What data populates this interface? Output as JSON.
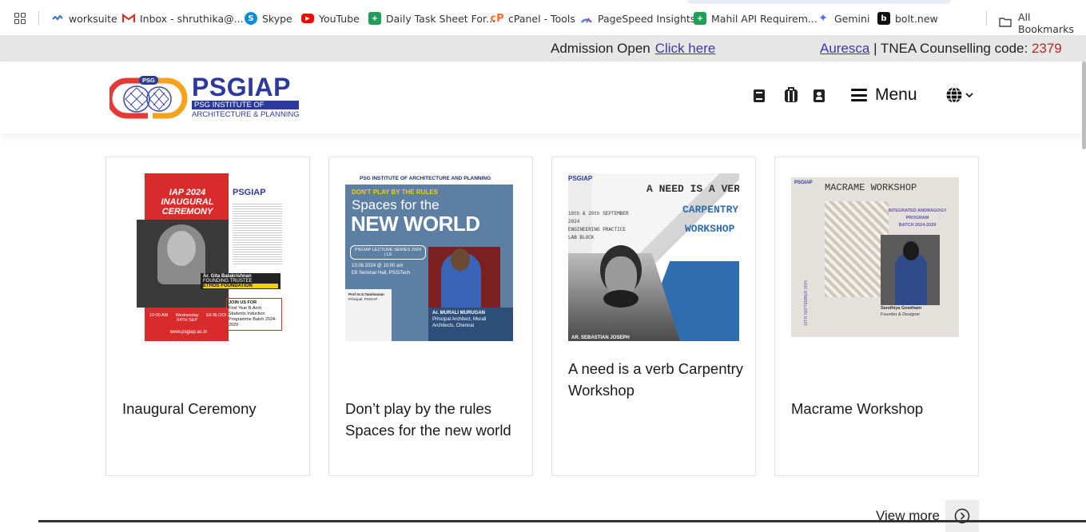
{
  "bookmarks": {
    "items": [
      {
        "label": "worksuite",
        "icon": "worksuite-icon",
        "color": "#2d6fd3"
      },
      {
        "label": "Inbox - shruthika@...",
        "icon": "gmail-icon",
        "color": "#d93025"
      },
      {
        "label": "Skype",
        "icon": "skype-icon",
        "color": "#0b8bdc"
      },
      {
        "label": "YouTube",
        "icon": "youtube-icon",
        "color": "#ff0000"
      },
      {
        "label": "Daily Task Sheet For...",
        "icon": "sheets-icon",
        "color": "#1e9e57"
      },
      {
        "label": "cPanel - Tools",
        "icon": "cpanel-icon",
        "color": "#ff6c2c"
      },
      {
        "label": "PageSpeed Insights",
        "icon": "pagespeed-icon",
        "color": "#4285f4"
      },
      {
        "label": "Mahil API Requirem...",
        "icon": "sheets-icon",
        "color": "#1e9e57"
      },
      {
        "label": "Gemini",
        "icon": "gemini-icon",
        "color": "#4a6cf7"
      },
      {
        "label": "bolt.new",
        "icon": "bolt-icon",
        "color": "#111111"
      }
    ],
    "all_label": "All Bookmarks"
  },
  "infobar": {
    "admission_text": "Admission Open",
    "admission_link": "Click here",
    "brand_link": "Auresca",
    "tnea_text": " | TNEA Counselling code: ",
    "tnea_code": "2379"
  },
  "header": {
    "logo_name": "PSGIAP",
    "logo_badge": "PSG",
    "logo_sub1": "PSG INSTITUTE OF",
    "logo_sub2": "ARCHITECTURE & PLANNING",
    "menu_label": "Menu",
    "language_icon": "globe-icon"
  },
  "cards": [
    {
      "title": "Inaugural Ceremony",
      "poster": {
        "heading1": "IAP 2024",
        "heading2": "INAUGURAL",
        "heading3": "CEREMONY",
        "brand": "PSGIAP",
        "speaker": "Ar. Gita Balakrishnan",
        "role": "FOUNDING TRUSTEE",
        "org": "ETHOS FOUNDATION",
        "time": "10:00 AM",
        "day": "Wednesday",
        "date": "04TH SEP",
        "venue": "E6 BLOCK",
        "join": "JOIN US FOR",
        "join_detail": "First Year B.Arch Students Induction Programme Batch 2024-2029",
        "url": "www.psgiap.ac.in"
      }
    },
    {
      "title": "Don’t play by the rules Spaces for the new world",
      "poster": {
        "header": "PSG INSTITUTE OF ARCHITECTURE AND PLANNING",
        "tag": "DON'T PLAY BY THE RULES",
        "line1": "Spaces for the",
        "line2": "NEW WORLD",
        "series": "PSGIAP LECTURE SERIES 2024 | L9",
        "datetime": "10.08.2024 @ 10:00 am",
        "venue": "E6 Seminar Hall, PSGiTech",
        "speaker": "Ar. MURALI MURUGAN",
        "speaker_role": "Principal Architect, Murali Architects, Chennai",
        "host1": "Prof Ar.S.Tamilvanan",
        "host1_role": "Principal, PSGIAP"
      }
    },
    {
      "title": "A need is a verb Carpentry Workshop",
      "poster": {
        "brand": "PSGIAP",
        "line1": "A NEED IS A VERB",
        "line2": "CARPENTRY",
        "line3": "WORKSHOP",
        "date": "19th & 20th SEPTEMBER 2024",
        "venue": "ENGINEERING PRACTICE LAB BLOCK",
        "speaker": "AR. SEBASTIAN JOSEPH"
      }
    },
    {
      "title": "Macrame Workshop",
      "poster": {
        "brand": "PSGIAP",
        "heading": "MACRAME WORKSHOP",
        "program": "INTEGRATED ANDRAGOGY PROGRAM",
        "batch": "BATCH 2024-2029",
        "date": "12TH SEPTEMBER 2024",
        "speaker": "Sandhiya Gowtham",
        "speaker_role": "Founder & Designer"
      }
    }
  ],
  "view_more": "View more"
}
